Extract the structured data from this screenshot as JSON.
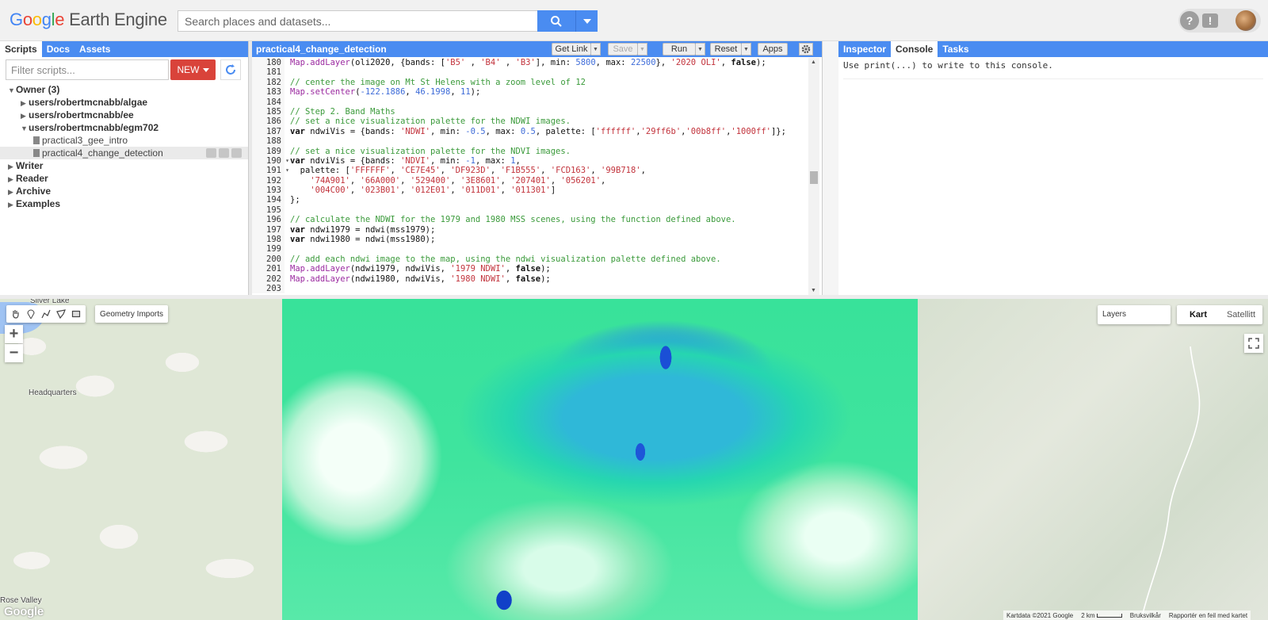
{
  "header": {
    "logo_letters": [
      "G",
      "o",
      "o",
      "g",
      "l",
      "e"
    ],
    "product": "Earth Engine",
    "search_placeholder": "Search places and datasets...",
    "help_icon": "?",
    "feedback_icon": "!"
  },
  "left_panel": {
    "tabs": [
      {
        "label": "Scripts"
      },
      {
        "label": "Docs"
      },
      {
        "label": "Assets"
      }
    ],
    "filter_placeholder": "Filter scripts...",
    "new_button": "NEW",
    "tree": [
      {
        "label": "Owner  (3)",
        "level": 0,
        "expanded": true
      },
      {
        "label": "users/robertmcnabb/algae",
        "level": 1,
        "expanded": false
      },
      {
        "label": "users/robertmcnabb/ee",
        "level": 1,
        "expanded": false
      },
      {
        "label": "users/robertmcnabb/egm702",
        "level": 1,
        "expanded": true
      },
      {
        "label": "practical3_gee_intro",
        "level": 2,
        "type": "file"
      },
      {
        "label": "practical4_change_detection",
        "level": 2,
        "type": "file",
        "selected": true
      },
      {
        "label": "Writer",
        "level": 0,
        "expanded": false
      },
      {
        "label": "Reader",
        "level": 0,
        "expanded": false
      },
      {
        "label": "Archive",
        "level": 0,
        "expanded": false
      },
      {
        "label": "Examples",
        "level": 0,
        "expanded": false
      }
    ]
  },
  "editor": {
    "title": "practical4_change_detection",
    "buttons": {
      "get_link": "Get Link",
      "save": "Save",
      "run": "Run",
      "reset": "Reset",
      "apps": "Apps"
    },
    "lines": [
      {
        "n": "180",
        "tokens": [
          [
            "fn",
            "Map.addLayer"
          ],
          [
            "",
            "(oli2020, {bands: ["
          ],
          [
            "str",
            "'B5'"
          ],
          [
            "",
            " , "
          ],
          [
            "str",
            "'B4'"
          ],
          [
            "",
            " , "
          ],
          [
            "str",
            "'B3'"
          ],
          [
            "",
            "], min: "
          ],
          [
            "num",
            "5800"
          ],
          [
            "",
            ", max: "
          ],
          [
            "num",
            "22500"
          ],
          [
            "",
            "}, "
          ],
          [
            "str",
            "'2020 OLI'"
          ],
          [
            "",
            ", "
          ],
          [
            "kw",
            "false"
          ],
          [
            "",
            ");"
          ]
        ]
      },
      {
        "n": "181",
        "tokens": []
      },
      {
        "n": "182",
        "tokens": [
          [
            "cm",
            "// center the image on Mt St Helens with a zoom level of 12"
          ]
        ]
      },
      {
        "n": "183",
        "tokens": [
          [
            "fn",
            "Map.setCenter"
          ],
          [
            "",
            "("
          ],
          [
            "num",
            "-122.1886"
          ],
          [
            "",
            ", "
          ],
          [
            "num",
            "46.1998"
          ],
          [
            "",
            ", "
          ],
          [
            "num",
            "11"
          ],
          [
            "",
            ");"
          ]
        ]
      },
      {
        "n": "184",
        "tokens": []
      },
      {
        "n": "185",
        "tokens": [
          [
            "cm",
            "// Step 2. Band Maths"
          ]
        ]
      },
      {
        "n": "186",
        "tokens": [
          [
            "cm",
            "// set a nice visualization palette for the NDWI images."
          ]
        ]
      },
      {
        "n": "187",
        "tokens": [
          [
            "kw",
            "var"
          ],
          [
            "",
            " ndwiVis = {bands: "
          ],
          [
            "str",
            "'NDWI'"
          ],
          [
            "",
            ", min: "
          ],
          [
            "num",
            "-0.5"
          ],
          [
            "",
            ", max: "
          ],
          [
            "num",
            "0.5"
          ],
          [
            "",
            ", palette: ["
          ],
          [
            "str",
            "'ffffff'"
          ],
          [
            "",
            ","
          ],
          [
            "str",
            "'29ff6b'"
          ],
          [
            "",
            ","
          ],
          [
            "str",
            "'00b8ff'"
          ],
          [
            "",
            ","
          ],
          [
            "str",
            "'1000ff'"
          ],
          [
            "",
            "]};"
          ]
        ]
      },
      {
        "n": "188",
        "tokens": []
      },
      {
        "n": "189",
        "tokens": [
          [
            "cm",
            "// set a nice visualization palette for the NDVI images."
          ]
        ]
      },
      {
        "n": "190",
        "fold": true,
        "tokens": [
          [
            "kw",
            "var"
          ],
          [
            "",
            " ndviVis = {bands: "
          ],
          [
            "str",
            "'NDVI'"
          ],
          [
            "",
            ", min: "
          ],
          [
            "num",
            "-1"
          ],
          [
            "",
            ", max: "
          ],
          [
            "num",
            "1"
          ],
          [
            "",
            ","
          ]
        ]
      },
      {
        "n": "191",
        "fold": true,
        "tokens": [
          [
            "",
            "  palette: ["
          ],
          [
            "str",
            "'FFFFFF'"
          ],
          [
            "",
            ", "
          ],
          [
            "str",
            "'CE7E45'"
          ],
          [
            "",
            ", "
          ],
          [
            "str",
            "'DF923D'"
          ],
          [
            "",
            ", "
          ],
          [
            "str",
            "'F1B555'"
          ],
          [
            "",
            ", "
          ],
          [
            "str",
            "'FCD163'"
          ],
          [
            "",
            ", "
          ],
          [
            "str",
            "'99B718'"
          ],
          [
            "",
            ","
          ]
        ]
      },
      {
        "n": "192",
        "tokens": [
          [
            "",
            "    "
          ],
          [
            "str",
            "'74A901'"
          ],
          [
            "",
            ", "
          ],
          [
            "str",
            "'66A000'"
          ],
          [
            "",
            ", "
          ],
          [
            "str",
            "'529400'"
          ],
          [
            "",
            ", "
          ],
          [
            "str",
            "'3E8601'"
          ],
          [
            "",
            ", "
          ],
          [
            "str",
            "'207401'"
          ],
          [
            "",
            ", "
          ],
          [
            "str",
            "'056201'"
          ],
          [
            "",
            ","
          ]
        ]
      },
      {
        "n": "193",
        "tokens": [
          [
            "",
            "    "
          ],
          [
            "str",
            "'004C00'"
          ],
          [
            "",
            ", "
          ],
          [
            "str",
            "'023B01'"
          ],
          [
            "",
            ", "
          ],
          [
            "str",
            "'012E01'"
          ],
          [
            "",
            ", "
          ],
          [
            "str",
            "'011D01'"
          ],
          [
            "",
            ", "
          ],
          [
            "str",
            "'011301'"
          ],
          [
            "",
            "]"
          ]
        ]
      },
      {
        "n": "194",
        "tokens": [
          [
            "",
            "};"
          ]
        ]
      },
      {
        "n": "195",
        "tokens": []
      },
      {
        "n": "196",
        "tokens": [
          [
            "cm",
            "// calculate the NDWI for the 1979 and 1980 MSS scenes, using the function defined above."
          ]
        ]
      },
      {
        "n": "197",
        "tokens": [
          [
            "kw",
            "var"
          ],
          [
            "",
            " ndwi1979 = ndwi(mss1979);"
          ]
        ]
      },
      {
        "n": "198",
        "tokens": [
          [
            "kw",
            "var"
          ],
          [
            "",
            " ndwi1980 = ndwi(mss1980);"
          ]
        ]
      },
      {
        "n": "199",
        "tokens": []
      },
      {
        "n": "200",
        "tokens": [
          [
            "cm",
            "// add each ndwi image to the map, using the ndwi visualization palette defined above."
          ]
        ]
      },
      {
        "n": "201",
        "tokens": [
          [
            "fn",
            "Map.addLayer"
          ],
          [
            "",
            "(ndwi1979, ndwiVis, "
          ],
          [
            "str",
            "'1979 NDWI'"
          ],
          [
            "",
            ", "
          ],
          [
            "kw",
            "false"
          ],
          [
            "",
            ");"
          ]
        ]
      },
      {
        "n": "202",
        "tokens": [
          [
            "fn",
            "Map.addLayer"
          ],
          [
            "",
            "(ndwi1980, ndwiVis, "
          ],
          [
            "str",
            "'1980 NDWI'"
          ],
          [
            "",
            ", "
          ],
          [
            "kw",
            "false"
          ],
          [
            "",
            ");"
          ]
        ]
      },
      {
        "n": "203",
        "tokens": []
      }
    ]
  },
  "right_panel": {
    "tabs": [
      {
        "label": "Inspector"
      },
      {
        "label": "Console"
      },
      {
        "label": "Tasks"
      }
    ],
    "active_tab": "Console",
    "console_message": "Use print(...) to write to this console."
  },
  "map": {
    "labels": {
      "silver_lake": "Silver Lake",
      "headquarters": "Headquarters",
      "rose_valley": "Rose Valley"
    },
    "geometry_imports": "Geometry Imports",
    "layers": "Layers",
    "map_types": [
      {
        "label": "Kart",
        "active": true
      },
      {
        "label": "Satellitt",
        "active": false
      }
    ],
    "attribution": {
      "data": "Kartdata ©2021 Google",
      "scale": "2 km",
      "terms": "Bruksvilkår",
      "report": "Rapportér en feil med kartet"
    },
    "watermark": "Google",
    "ndwi_palette": [
      "#ffffff",
      "#29ff6b",
      "#00b8ff",
      "#1000ff"
    ]
  },
  "colors": {
    "accent": "#4a8cf1",
    "new_button": "#d9433a"
  }
}
